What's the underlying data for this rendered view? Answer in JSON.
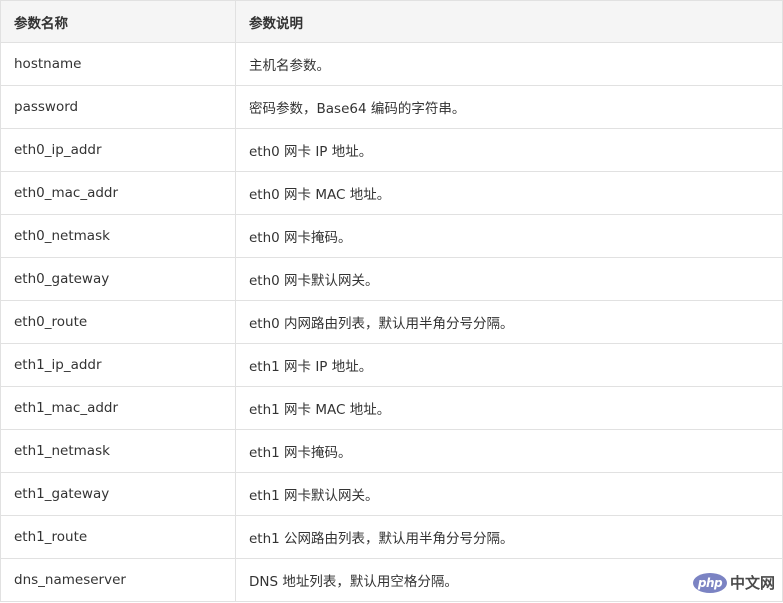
{
  "table": {
    "headers": [
      "参数名称",
      "参数说明"
    ],
    "rows": [
      [
        "hostname",
        "主机名参数。"
      ],
      [
        "password",
        "密码参数，Base64 编码的字符串。"
      ],
      [
        "eth0_ip_addr",
        "eth0 网卡 IP 地址。"
      ],
      [
        "eth0_mac_addr",
        "eth0 网卡 MAC 地址。"
      ],
      [
        "eth0_netmask",
        "eth0 网卡掩码。"
      ],
      [
        "eth0_gateway",
        "eth0 网卡默认网关。"
      ],
      [
        "eth0_route",
        "eth0 内网路由列表，默认用半角分号分隔。"
      ],
      [
        "eth1_ip_addr",
        "eth1 网卡 IP 地址。"
      ],
      [
        "eth1_mac_addr",
        "eth1 网卡 MAC 地址。"
      ],
      [
        "eth1_netmask",
        "eth1 网卡掩码。"
      ],
      [
        "eth1_gateway",
        "eth1 网卡默认网关。"
      ],
      [
        "eth1_route",
        "eth1 公网路由列表，默认用半角分号分隔。"
      ],
      [
        "dns_nameserver",
        "DNS 地址列表，默认用空格分隔。"
      ]
    ]
  },
  "watermark": {
    "badge": "php",
    "text": "中文网"
  },
  "colors": {
    "header_bg": "#f5f5f5",
    "border": "#e1e1e1",
    "text": "#333333",
    "watermark_badge": "#7b83c3"
  }
}
